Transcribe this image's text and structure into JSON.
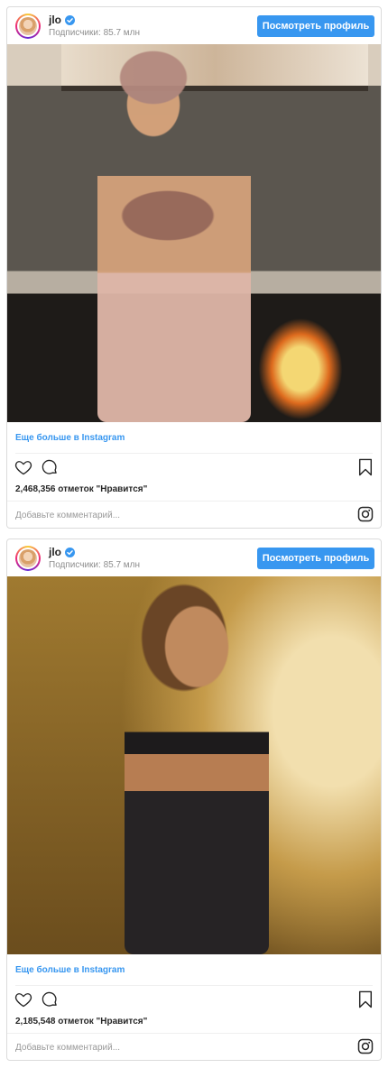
{
  "posts": [
    {
      "username": "jlo",
      "followers": "Подписчики: 85.7 млн",
      "view_profile_label": "Посмотреть профиль",
      "more_label": "Еще больше в Instagram",
      "likes": "2,468,356 отметок \"Нравится\"",
      "comment_placeholder": "Добавьте комментарий..."
    },
    {
      "username": "jlo",
      "followers": "Подписчики: 85.7 млн",
      "view_profile_label": "Посмотреть профиль",
      "more_label": "Еще больше в Instagram",
      "likes": "2,185,548 отметок \"Нравится\"",
      "comment_placeholder": "Добавьте комментарий..."
    }
  ],
  "icons": {
    "verified": "verified-badge-icon",
    "like": "heart-icon",
    "comment": "comment-icon",
    "bookmark": "bookmark-icon",
    "instagram": "instagram-logo-icon"
  },
  "colors": {
    "accent": "#3897f0",
    "text": "#262626",
    "secondary_text": "#8e8e8e",
    "border": "#dbdbdb"
  }
}
